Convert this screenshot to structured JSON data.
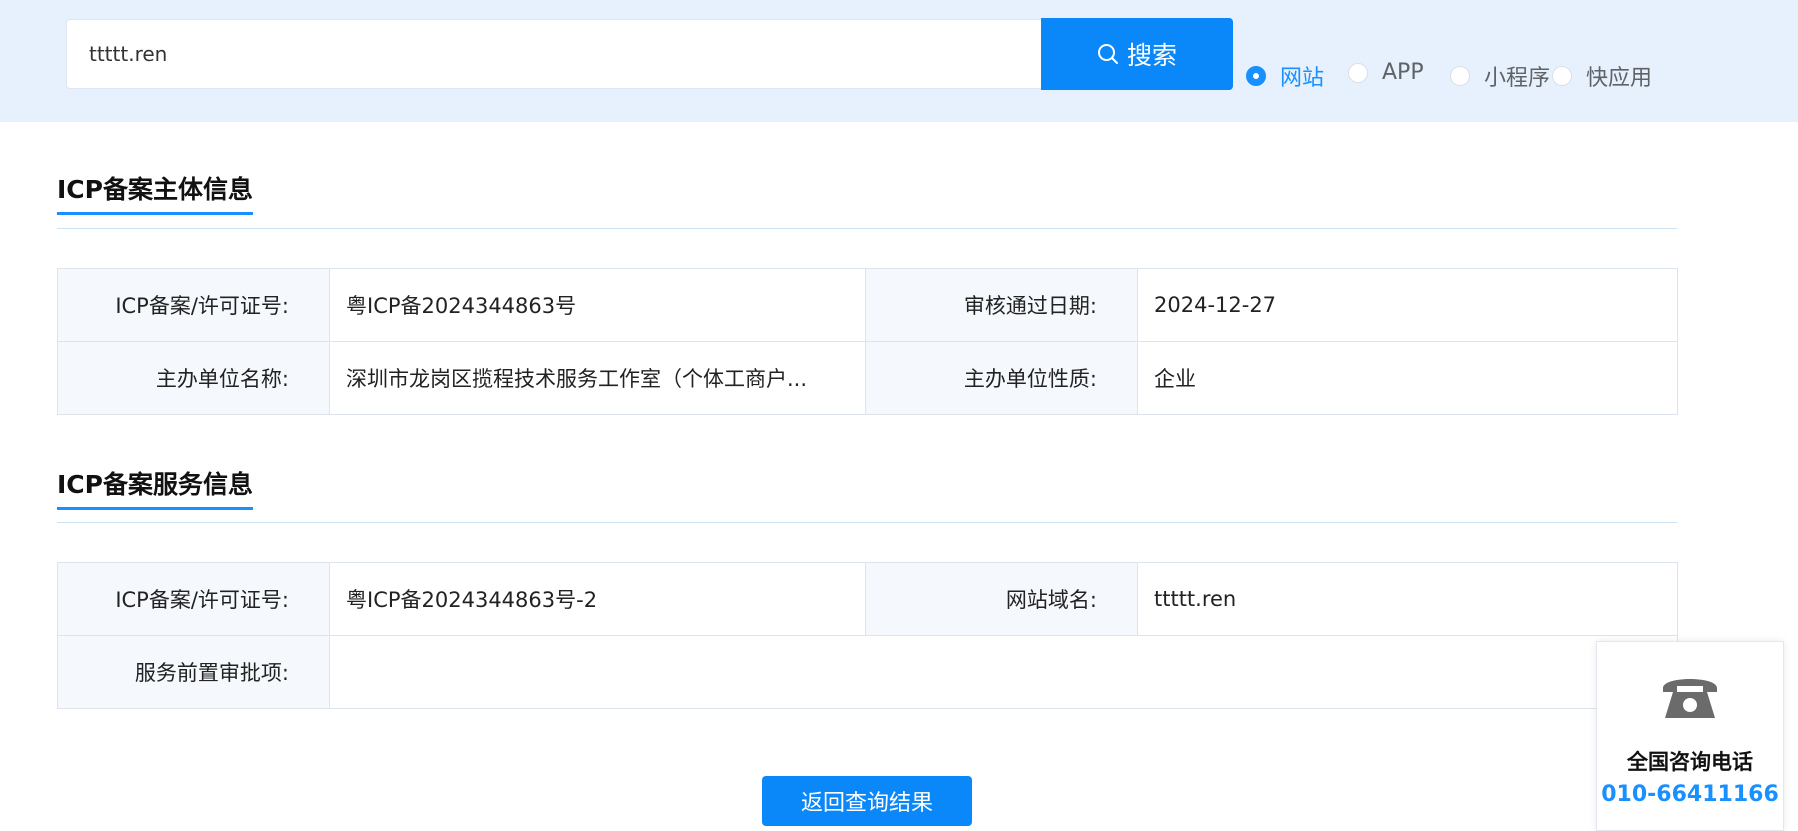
{
  "search": {
    "value": "ttttt.ren",
    "button_label": "搜索"
  },
  "type_options": [
    {
      "label": "网站",
      "checked": true
    },
    {
      "label": "APP",
      "checked": false
    },
    {
      "label": "小程序",
      "checked": false
    },
    {
      "label": "快应用",
      "checked": false
    }
  ],
  "subject_section": {
    "title": "ICP备案主体信息",
    "rows": [
      {
        "label1": "ICP备案/许可证号:",
        "value1": "粤ICP备2024344863号",
        "label2": "审核通过日期:",
        "value2": "2024-12-27"
      },
      {
        "label1": "主办单位名称:",
        "value1": "深圳市龙岗区揽程技术服务工作室（个体工商户...",
        "label2": "主办单位性质:",
        "value2": "企业"
      }
    ]
  },
  "service_section": {
    "title": "ICP备案服务信息",
    "rows": [
      {
        "label1": "ICP备案/许可证号:",
        "value1": "粤ICP备2024344863号-2",
        "label2": "网站域名:",
        "value2": "ttttt.ren"
      },
      {
        "label1": "服务前置审批项:",
        "value1": ""
      }
    ]
  },
  "back_button": "返回查询结果",
  "contact": {
    "icon": "phone-icon",
    "title": "全国咨询电话",
    "number": "010-66411166"
  },
  "colors": {
    "accent": "#1890ff",
    "button": "#0a87f8",
    "topbar_bg": "#e6f1fd"
  }
}
